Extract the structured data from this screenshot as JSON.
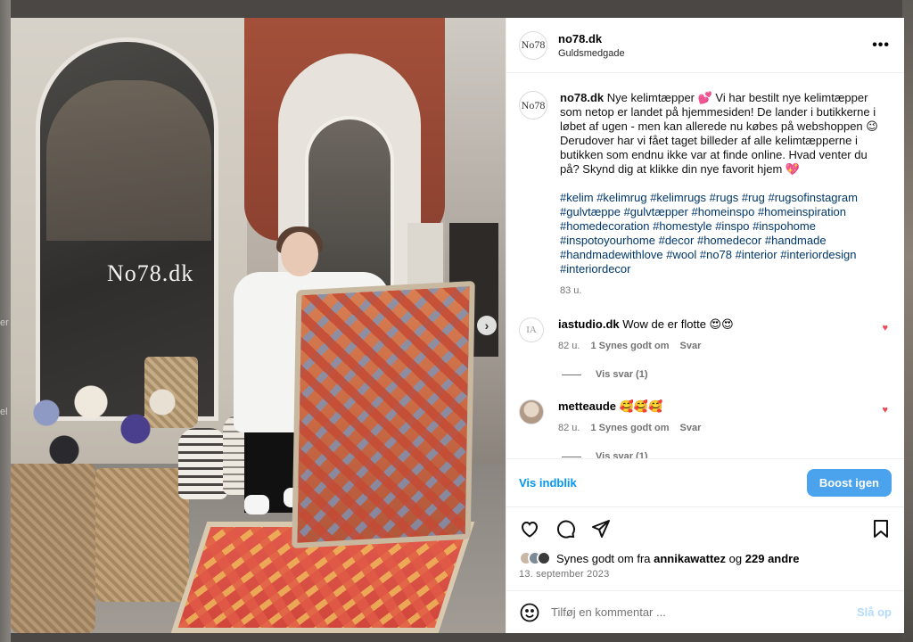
{
  "backdrop": {
    "left_fragments": [
      "er",
      "el"
    ]
  },
  "post": {
    "photo": {
      "shop_sign": "No78.dk",
      "next_arrow": "›"
    },
    "header": {
      "avatar_text": "No78",
      "username": "no78.dk",
      "location": "Guldsmedgade",
      "more": "•••"
    },
    "caption": {
      "username": "no78.dk",
      "text": "Nye kelimtæpper 💕 Vi har bestilt nye kelimtæpper som netop er landet på hjemmesiden! De lander i butikkerne i løbet af ugen - men kan allerede nu købes på webshoppen 😉 Derudover har vi fået taget billeder af alle kelimtæpperne i butikken som endnu ikke var at finde online. Hvad venter du på? Skynd dig at klikke din nye favorit hjem 💖",
      "hashtags": [
        "#kelim",
        "#kelimrug",
        "#kelimrugs",
        "#rugs",
        "#rug",
        "#rugsofinstagram",
        "#gulvtæppe",
        "#gulvtæpper",
        "#homeinspo",
        "#homeinspiration",
        "#homedecoration",
        "#homestyle",
        "#inspo",
        "#inspohome",
        "#inspotoyourhome",
        "#decor",
        "#homedecor",
        "#handmade",
        "#handmadewithlove",
        "#wool",
        "#no78",
        "#interior",
        "#interiordesign",
        "#interiordecor"
      ],
      "age": "83 u."
    },
    "comments": [
      {
        "avatar_text": "IA",
        "username": "iastudio.dk",
        "text": "Wow de er flotte 😍😍",
        "age": "82 u.",
        "likes": "1 Synes godt om",
        "reply": "Svar",
        "view_replies": "Vis svar (1)",
        "heart": "♥"
      },
      {
        "avatar_text": "",
        "username": "metteaude",
        "text": "🥰🥰🥰",
        "age": "82 u.",
        "likes": "1 Synes godt om",
        "reply": "Svar",
        "view_replies": "Vis svar (1)",
        "heart": "♥"
      }
    ],
    "insight": {
      "link": "Vis indblik",
      "boost": "Boost igen"
    },
    "likes": {
      "prefix": "Synes godt om fra",
      "first_user": "annikawattez",
      "joiner": "og",
      "others": "229 andre"
    },
    "date": "13. september 2023",
    "comment_bar": {
      "placeholder": "Tilføj en kommentar ...",
      "post": "Slå op"
    }
  },
  "colors": {
    "accent": "#0095f6",
    "boost_bg": "#4aa3ec",
    "hashtag": "#00376b",
    "heart": "#ed4956"
  }
}
